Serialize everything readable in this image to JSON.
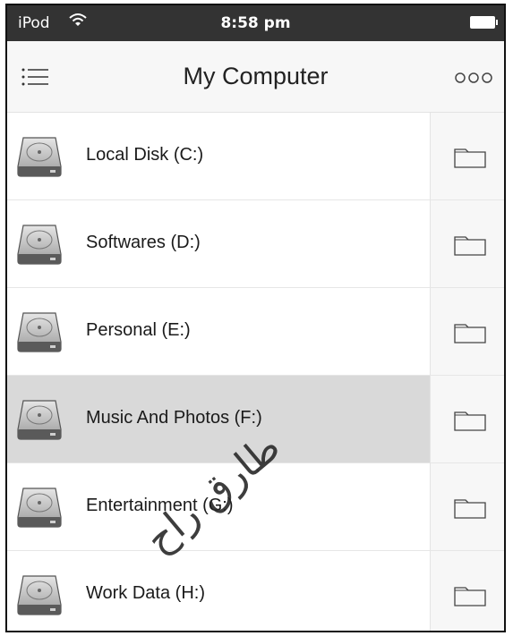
{
  "status_bar": {
    "carrier": "iPod",
    "time": "8:58 pm",
    "wifi_icon": "wifi-icon",
    "battery_icon": "battery-icon"
  },
  "nav": {
    "title": "My Computer",
    "menu_icon": "menu-icon",
    "more_icon": "more-options-icon"
  },
  "drives": [
    {
      "label": "Local Disk (C:)",
      "selected": false
    },
    {
      "label": "Softwares (D:)",
      "selected": false
    },
    {
      "label": "Personal (E:)",
      "selected": false
    },
    {
      "label": "Music And Photos (F:)",
      "selected": true
    },
    {
      "label": "Entertainment (G:)",
      "selected": false
    },
    {
      "label": "Work Data (H:)",
      "selected": false
    }
  ],
  "watermark": "طارق راح",
  "colors": {
    "status_bar": "#333333",
    "selected_row": "#d9d9d9",
    "row": "#ffffff"
  }
}
